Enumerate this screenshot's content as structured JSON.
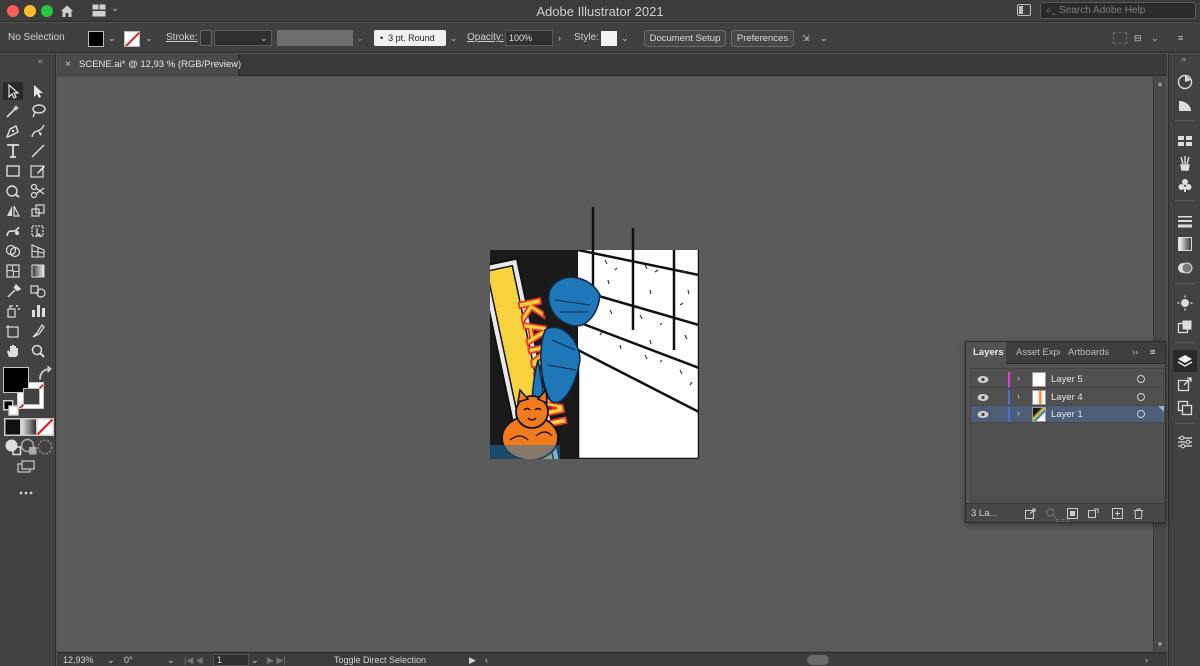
{
  "window": {
    "title": "Adobe Illustrator 2021",
    "search_placeholder": "Search Adobe Help"
  },
  "control_bar": {
    "selection_label": "No Selection",
    "stroke_label": "Stroke:",
    "brush_profile": "3 pt. Round",
    "opacity_label": "Opacity:",
    "opacity_value": "100%",
    "style_label": "Style:",
    "document_setup": "Document Setup",
    "preferences": "Preferences"
  },
  "document": {
    "tab_title": "SCENE.ai* @ 12,93 % (RGB/Preview)",
    "close_glyph": "×",
    "artwork_text": "KANEMI"
  },
  "status_bar": {
    "zoom": "12,93%",
    "rotation": "0°",
    "artboard_number": "1",
    "tool_hint": "Toggle Direct Selection"
  },
  "layers_panel": {
    "tabs": [
      "Layers",
      "Asset Export",
      "Artboards"
    ],
    "layers": [
      {
        "name": "Layer 5",
        "color": "#e040e0",
        "selected": false
      },
      {
        "name": "Layer 4",
        "color": "#4f6bd8",
        "selected": false
      },
      {
        "name": "Layer 1",
        "color": "#4f6bd8",
        "selected": true
      }
    ],
    "count_label": "3 La..."
  },
  "colors": {
    "fill": "#000000",
    "stroke": "none",
    "selection_row": "#4d5e78",
    "accent_orange": "#f07a1c",
    "accent_blue": "#1e77b8",
    "sign_yellow": "#f7d23c",
    "sign_red": "#e8372c"
  }
}
